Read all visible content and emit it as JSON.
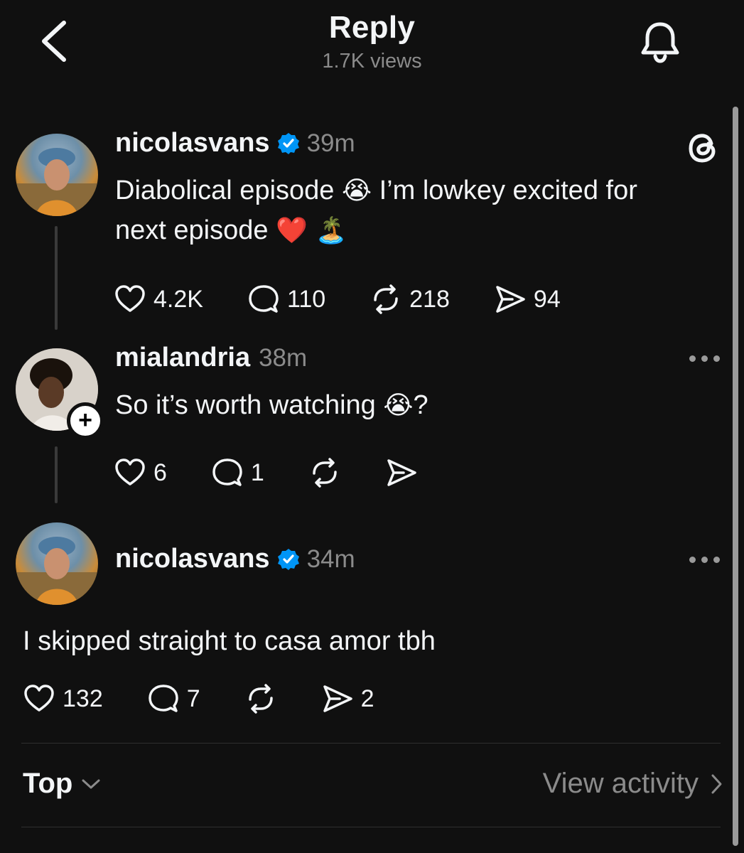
{
  "header": {
    "title": "Reply",
    "views": "1.7K views"
  },
  "posts": [
    {
      "username": "nicolasvans",
      "verified": true,
      "time": "39m",
      "text_line1": "Diabolical episode",
      "emoji1": "😭",
      "text_line1b": "I’m lowkey excited for",
      "text_line2": "next episode",
      "emoji2": "❤️",
      "emoji3": "🏝️",
      "likes": "4.2K",
      "replies": "110",
      "reposts": "218",
      "shares": "94"
    },
    {
      "username": "mialandria",
      "verified": false,
      "time": "38m",
      "text": "So it’s worth watching",
      "emoji": "😭",
      "text_after": "?",
      "likes": "6",
      "replies": "1"
    },
    {
      "username": "nicolasvans",
      "verified": true,
      "time": "34m",
      "text": "I skipped straight to casa amor tbh",
      "likes": "132",
      "replies": "7",
      "shares": "2"
    }
  ],
  "footer": {
    "sort_label": "Top",
    "view_activity": "View activity"
  },
  "colors": {
    "background": "#101010",
    "verified": "#0095f6",
    "secondary_text": "#8b8b8b"
  }
}
